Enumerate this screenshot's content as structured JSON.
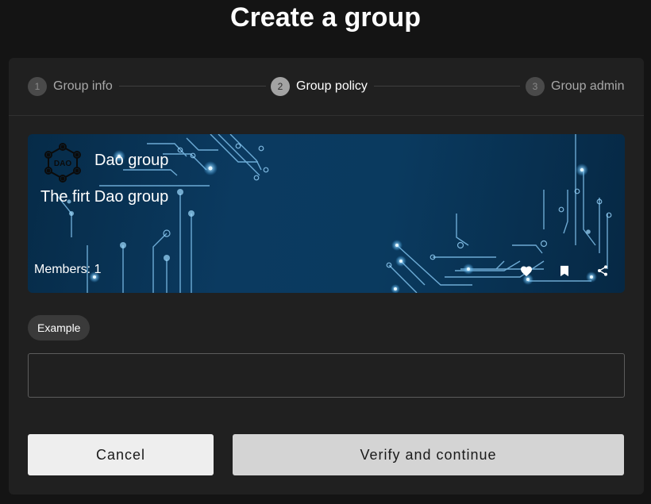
{
  "page": {
    "title": "Create a group"
  },
  "stepper": {
    "steps": [
      {
        "number": "1",
        "label": "Group info",
        "state": "inactive"
      },
      {
        "number": "2",
        "label": "Group policy",
        "state": "active"
      },
      {
        "number": "3",
        "label": "Group admin",
        "state": "inactive"
      }
    ]
  },
  "group_card": {
    "logo_text": "DAO",
    "name": "Dao group",
    "description": "The firt Dao group",
    "members": "Members: 1",
    "actions": [
      {
        "icon": "heart-icon"
      },
      {
        "icon": "bookmark-icon"
      },
      {
        "icon": "share-icon"
      }
    ]
  },
  "form": {
    "chip_label": "Example",
    "input_value": "",
    "input_placeholder": ""
  },
  "buttons": {
    "cancel": "Cancel",
    "verify": "Verify and continue"
  },
  "colors": {
    "page_bg": "#141414",
    "panel_bg": "#202020",
    "banner_bg": "#0b3a60",
    "circuit": "#8fd3ff",
    "cancel_bg": "#eeeeee",
    "verify_bg": "#d4d4d4"
  }
}
